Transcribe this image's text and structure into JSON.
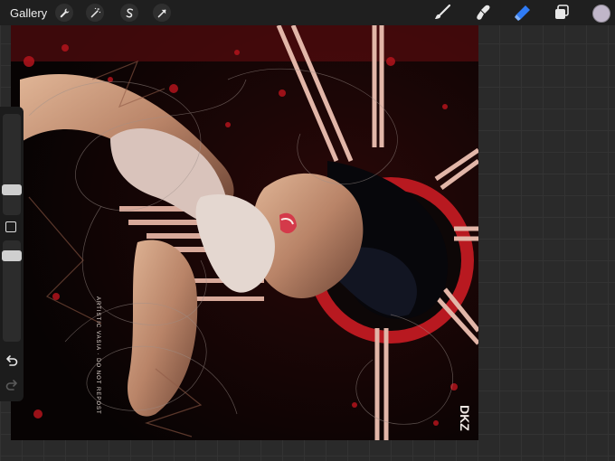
{
  "topbar": {
    "gallery_label": "Gallery",
    "left_tools": [
      {
        "icon": "wrench-icon",
        "name": "actions"
      },
      {
        "icon": "magic-wand-icon",
        "name": "adjustments"
      },
      {
        "icon": "selection-s-icon",
        "name": "selection"
      },
      {
        "icon": "transform-arrow-icon",
        "name": "transform"
      }
    ],
    "right_tools": [
      {
        "icon": "brush-icon",
        "name": "paint",
        "active": false
      },
      {
        "icon": "smudge-icon",
        "name": "smudge",
        "active": false
      },
      {
        "icon": "eraser-icon",
        "name": "erase",
        "active": true
      },
      {
        "icon": "layers-icon",
        "name": "layers",
        "active": false
      }
    ],
    "active_color": "#c0b6c9",
    "accent_color": "#2f7bf5"
  },
  "artwork": {
    "signature_text": "ARTISTIC VASIA\nDO NOT REPOST",
    "logo_text": "DKZ"
  },
  "sidebar": {
    "brush_size_level": 0.3,
    "opacity_level": 0.3,
    "undo_icon": "undo-arrow-icon",
    "redo_icon": "redo-arrow-icon"
  }
}
